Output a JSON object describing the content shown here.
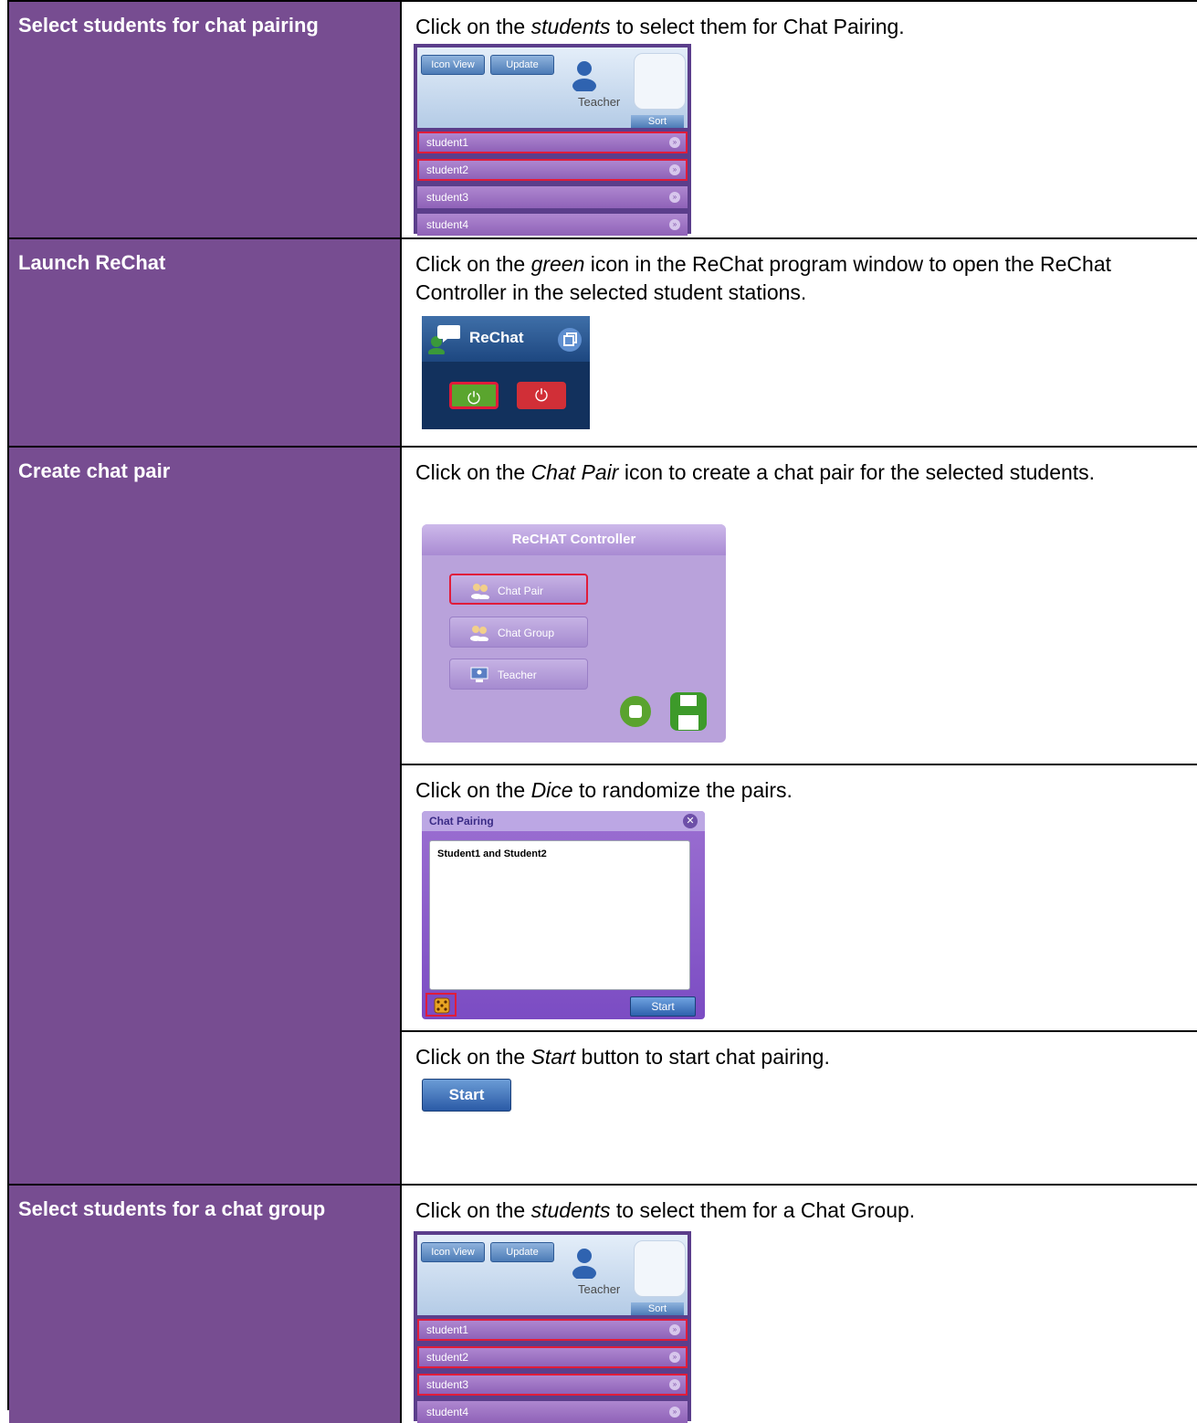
{
  "rows": [
    {
      "label": "Select students for chat pairing",
      "instr_pre": "Click on the ",
      "instr_em": "students",
      "instr_post": " to select them for Chat Pairing."
    },
    {
      "label": "Launch ReChat",
      "instr_pre": "Click on the ",
      "instr_em": "green",
      "instr_post": " icon in the ReChat program window to open the ReChat Controller in the selected student stations."
    },
    {
      "label": "Create chat pair",
      "sub1_pre": "Click on the ",
      "sub1_em": "Chat Pair",
      "sub1_post": " icon to create a chat pair for the selected students.",
      "sub2_pre": "Click on the ",
      "sub2_em": "Dice",
      "sub2_post": " to randomize the pairs.",
      "sub3_pre": "Click on the ",
      "sub3_em": "Start",
      "sub3_post": " button to start chat pairing."
    },
    {
      "label": "Select students for a chat group",
      "instr_pre": "Click on the ",
      "instr_em": "students",
      "instr_post": " to select them for a Chat Group."
    }
  ],
  "student_panel": {
    "icon_view": "Icon View",
    "update": "Update",
    "teacher": "Teacher",
    "sort": "Sort",
    "students": [
      "student1",
      "student2",
      "student3",
      "student4"
    ]
  },
  "rechat": {
    "title": "ReChat"
  },
  "controller": {
    "title": "ReCHAT Controller",
    "chat_pair": "Chat Pair",
    "chat_group": "Chat Group",
    "teacher": "Teacher"
  },
  "chat_pairing": {
    "title": "Chat Pairing",
    "entry": "Student1 and Student2",
    "start": "Start"
  },
  "start_button": "Start",
  "colors": {
    "label_bg": "#774d91",
    "highlight": "#e01c3a"
  }
}
